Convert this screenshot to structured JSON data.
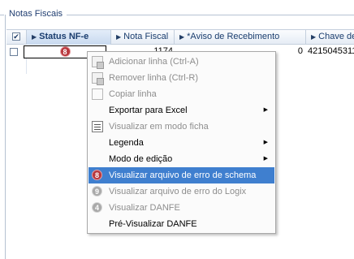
{
  "fieldset": {
    "title": "Notas Fiscais"
  },
  "grid": {
    "columns": [
      {
        "label": "Status NF-e",
        "arrow": "▶"
      },
      {
        "label": "Nota Fiscal",
        "arrow": "▶"
      },
      {
        "label": "*Aviso de Recebimento",
        "arrow": "▶"
      },
      {
        "label": "Chave de",
        "arrow": "▶"
      }
    ],
    "header_check": "✔",
    "rows": [
      {
        "status_badge": "8",
        "nota_fiscal": "1174",
        "aviso": "0",
        "chave": "4215045311"
      }
    ]
  },
  "context_menu": {
    "items": [
      {
        "label": "Adicionar linha (Ctrl-A)"
      },
      {
        "label": "Remover linha (Ctrl-R)"
      },
      {
        "label": "Copiar linha"
      },
      {
        "label": "Exportar para Excel",
        "sub": "▶"
      },
      {
        "label": "Visualizar em modo ficha"
      },
      {
        "label": "Legenda",
        "sub": "▶"
      },
      {
        "label": "Modo de edição",
        "sub": "▶"
      },
      {
        "label": "Visualizar arquivo de erro de schema",
        "badge": "8"
      },
      {
        "label": "Visualizar arquivo de erro do Logix",
        "badge": "9"
      },
      {
        "label": "Visualizar DANFE",
        "badge": "4"
      },
      {
        "label": "Pré-Visualizar DANFE"
      }
    ]
  },
  "colors": {
    "accent": "#3f7fcf",
    "error_badge": "#b8383d",
    "header_text": "#1a3d6e"
  }
}
